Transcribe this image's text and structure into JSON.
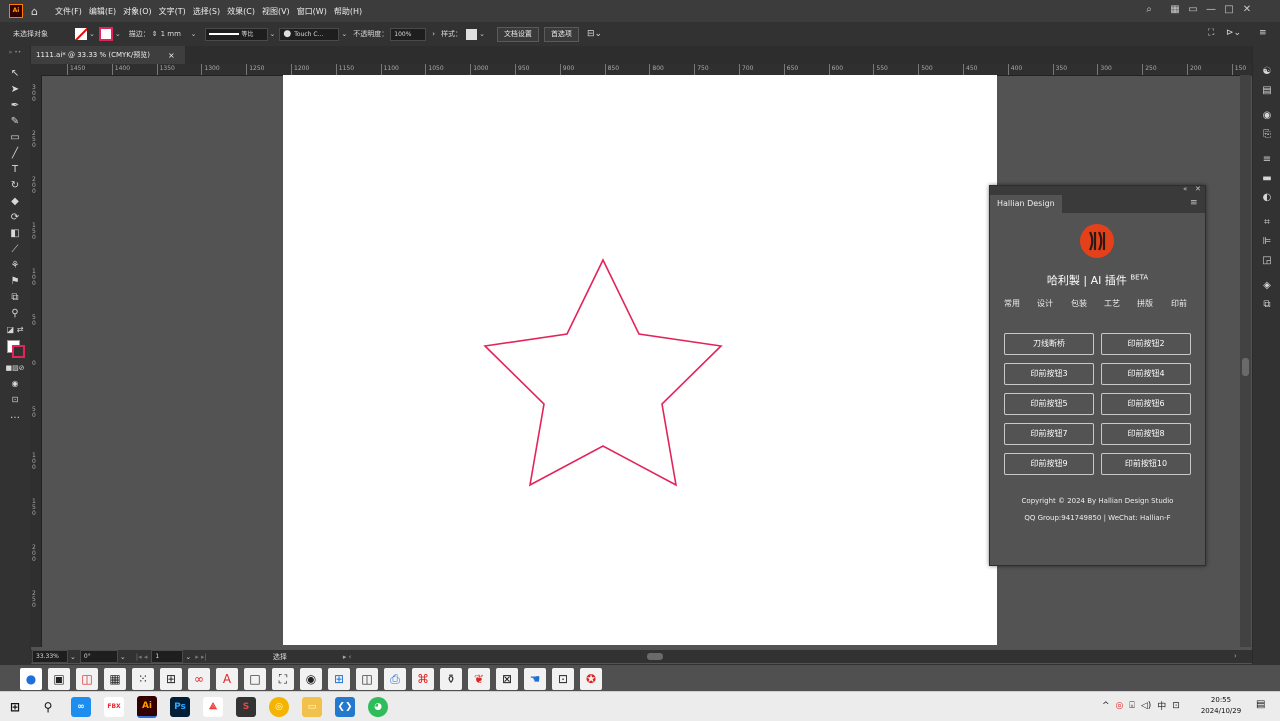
{
  "menubar": {
    "app_logo": "Ai",
    "items": [
      "文件(F)",
      "编辑(E)",
      "对象(O)",
      "文字(T)",
      "选择(S)",
      "效果(C)",
      "视图(V)",
      "窗口(W)",
      "帮助(H)"
    ],
    "window_controls": [
      "—",
      "□",
      "✕"
    ]
  },
  "controlbar": {
    "selection_status": "未选择对象",
    "stroke_label": "描边：",
    "stroke_value": "1 mm",
    "stroke_profile": "等比",
    "brush_label": "Touch C...",
    "opacity_label": "不透明度：",
    "opacity_value": "100%",
    "style_label": "样式：",
    "doc_setup_button": "文档设置",
    "prefs_button": "首选项"
  },
  "document_tab": {
    "title": "1111.ai* @ 33.33 % (CMYK/预览)",
    "close": "×"
  },
  "rulers": {
    "horizontal_ticks": [
      "1450",
      "1400",
      "1350",
      "1300",
      "1250",
      "1200",
      "1150",
      "1100",
      "1050",
      "1000",
      "950",
      "900",
      "850",
      "800",
      "750",
      "700",
      "650",
      "600",
      "550",
      "500",
      "450",
      "400",
      "350",
      "300",
      "250",
      "200",
      "150"
    ],
    "vertical_ticks": [
      "300",
      "250",
      "200",
      "150",
      "100",
      "50",
      "0",
      "50",
      "100",
      "150",
      "200",
      "250"
    ]
  },
  "artwork": {
    "shape": "star",
    "stroke_color": "#e3245a"
  },
  "statusbar": {
    "zoom": "33.33%",
    "rotation": "0°",
    "artboard_number": "1",
    "tool_name": "选择"
  },
  "plugin": {
    "tab_title": "Hallian Design",
    "brand_title": "哈利製 | AI 插件",
    "brand_badge": "BETA",
    "brand_color": "#e4411b",
    "categories": [
      "常用",
      "设计",
      "包装",
      "工艺",
      "拼版",
      "印前"
    ],
    "buttons": [
      "刀线断桥",
      "印前按钮2",
      "印前按钮3",
      "印前按钮4",
      "印前按钮5",
      "印前按钮6",
      "印前按钮7",
      "印前按钮8",
      "印前按钮9",
      "印前按钮10"
    ],
    "copyright": "Copyright © 2024 By Hallian Design Studio",
    "contact": "QQ Group:941749850 | WeChat: Hallian-F"
  },
  "taskbar": {
    "time": "20:55",
    "date": "2024/10/29",
    "ime": "中",
    "apps": [
      "start-icon",
      "search-icon",
      "baidu-netdisk-icon",
      "pdf-reader-icon",
      "illustrator-icon",
      "photoshop-icon",
      "acrobat-icon",
      "design-tool-icon",
      "chrome-icon",
      "file-explorer-icon",
      "vscode-icon",
      "wechat-icon"
    ]
  }
}
